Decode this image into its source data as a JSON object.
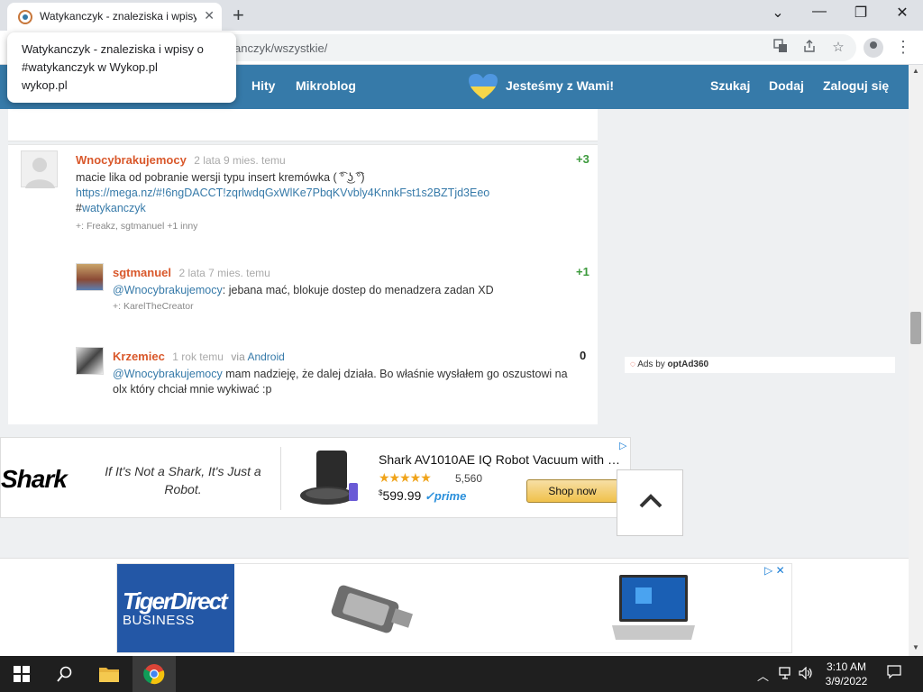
{
  "browser": {
    "tab_title": "Watykanczyk - znaleziska i wpisy",
    "tab_close": "✕",
    "new_tab": "+",
    "url": "anczyk/wszystkie/",
    "window_controls": [
      "⌄",
      "—",
      "❐",
      "✕"
    ]
  },
  "tooltip": {
    "title": "Watykanczyk - znaleziska i wpisy o #watykanczyk w Wykop.pl",
    "domain": "wykop.pl"
  },
  "nav": {
    "left_links": [
      "Hity",
      "Mikroblog"
    ],
    "slogan": "Jesteśmy z Wami!",
    "right_links": [
      "Szukaj",
      "Dodaj",
      "Zaloguj się"
    ]
  },
  "comments": [
    {
      "author": "Wnocybrakujemocy",
      "time": "2 lata 9 mies. temu",
      "score": "+3",
      "text": "macie lika od pobranie wersji typu insert kremówka ( ͡° ͜ʖ ͡°)",
      "link": "https://mega.nz/#!6ngDACCT!zqrlwdqGxWlKe7PbqKVvbly4KnnkFst1s2BZTjd3Eeo",
      "tag_hash": "#",
      "tag": "watykanczyk",
      "plus": "+: Freakz, sgtmanuel +1 inny"
    },
    {
      "author": "sgtmanuel",
      "time": "2 lata 7 mies. temu",
      "score": "+1",
      "mention": "@Wnocybrakujemocy",
      "text": ": jebana mać, blokuje dostep do menadzera zadan XD",
      "plus": "+: KarelTheCreator"
    },
    {
      "author": "Krzemiec",
      "time": "1 rok temu",
      "via_label": "via",
      "via": "Android",
      "score": "0",
      "mention": "@Wnocybrakujemocy",
      "text": " mam nadzieję, że dalej działa. Bo właśnie wysłałem go oszustowi na olx który chciał mnie wykiwać :p"
    }
  ],
  "ads_by": {
    "prefix": "Ads by",
    "brand": "optAd360"
  },
  "shark_ad": {
    "logo": "Shark",
    "tagline": "If It's Not a Shark, It's Just a Robot.",
    "product": "Shark AV1010AE IQ Robot Vacuum with …",
    "stars": "★★★★★",
    "reviews": "5,560",
    "price_sup": "$",
    "price": "599.99",
    "prime": "✓prime",
    "button": "Shop now"
  },
  "bottom_ad": {
    "logo_line1": "TigerDirect",
    "logo_line2": "BUSINESS"
  },
  "taskbar": {
    "time": "3:10 AM",
    "date": "3/9/2022"
  },
  "colors": {
    "wykop_blue": "#367aa9",
    "author_orange": "#d9582b",
    "score_green": "#3c9a3c"
  }
}
